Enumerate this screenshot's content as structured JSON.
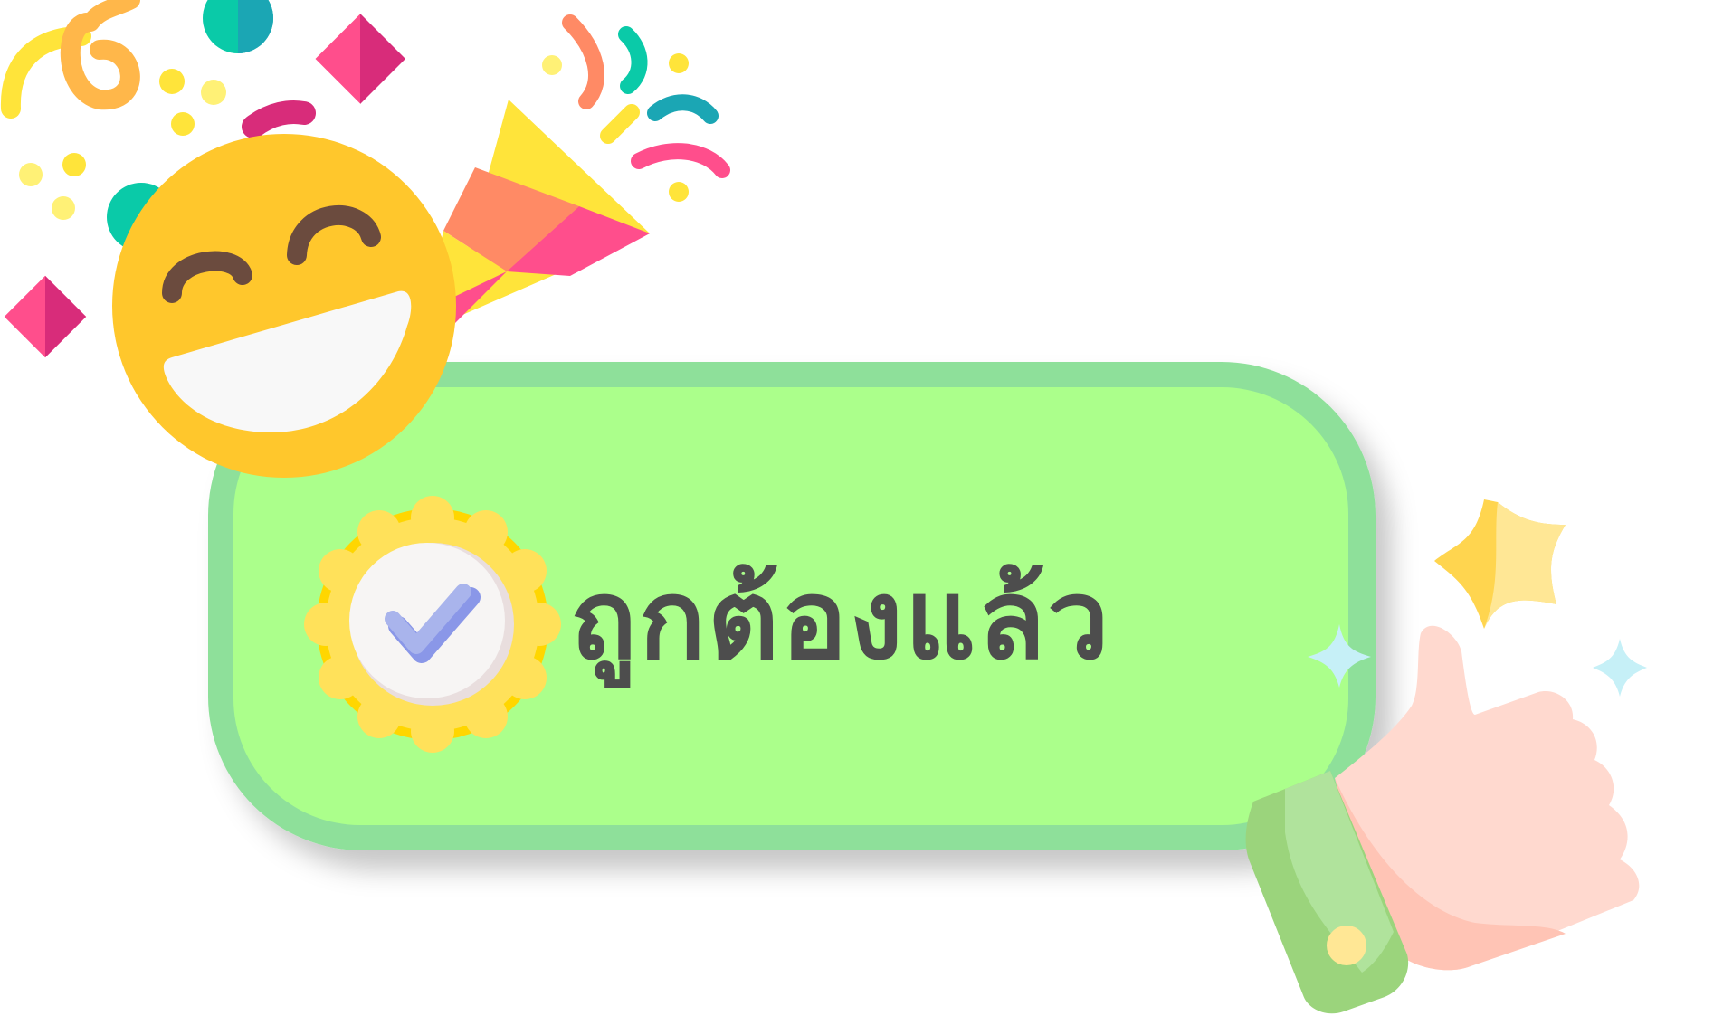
{
  "banner": {
    "text": "ถูกต้องแล้ว",
    "fill_color": "#abff8b",
    "border_color": "#8ee09a",
    "text_color": "#4d4d4d"
  },
  "decorations": {
    "left_icon": "check-badge-icon",
    "face_icon": "laughing-face-icon",
    "popper_icon": "party-popper-icon",
    "hand_icon": "thumbs-up-hand-icon",
    "sparkle_icon": "star-sparkle-icon"
  }
}
